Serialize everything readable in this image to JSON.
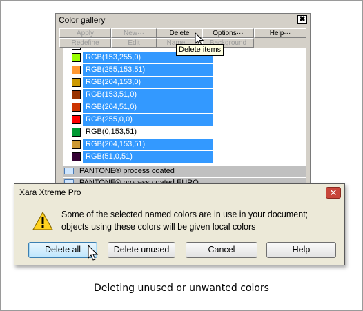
{
  "gallery": {
    "title": "Color gallery",
    "close_glyph": "✖",
    "toolbar_row1": [
      {
        "label": "Apply",
        "enabled": false
      },
      {
        "label": "New···",
        "enabled": false
      },
      {
        "label": "Delete",
        "enabled": true
      },
      {
        "label": "Options···",
        "enabled": true
      },
      {
        "label": "Help···",
        "enabled": true
      }
    ],
    "toolbar_row2": [
      {
        "label": "Redefine",
        "enabled": false
      },
      {
        "label": "Edit",
        "enabled": false
      },
      {
        "label": "Name···",
        "enabled": false
      },
      {
        "label": "Background",
        "enabled": false
      }
    ],
    "colors": [
      {
        "label": "RGB(153,255,0)",
        "swatch": "#99ff00",
        "selected": true
      },
      {
        "label": "RGB(255,153,51)",
        "swatch": "#ff9933",
        "selected": true
      },
      {
        "label": "RGB(204,153,0)",
        "swatch": "#cc9900",
        "selected": true
      },
      {
        "label": "RGB(153,51,0)",
        "swatch": "#993300",
        "selected": true
      },
      {
        "label": "RGB(204,51,0)",
        "swatch": "#cc3300",
        "selected": true
      },
      {
        "label": "RGB(255,0,0)",
        "swatch": "#ff0000",
        "selected": true
      },
      {
        "label": "RGB(0,153,51)",
        "swatch": "#009933",
        "selected": false
      },
      {
        "label": "RGB(204,153,51)",
        "swatch": "#cc9933",
        "selected": true
      },
      {
        "label": "RGB(51,0,51)",
        "swatch": "#330033",
        "selected": true
      }
    ],
    "folders": [
      {
        "label": "PANTONE® process coated"
      },
      {
        "label": "PANTONE® process coated EURO"
      }
    ],
    "tooltip": "Delete items"
  },
  "dialog": {
    "title": "Xara Xtreme Pro",
    "close_glyph": "✕",
    "message_line1": "Some of the selected named colors are in use in your document;",
    "message_line2": "objects using these colors will be given local colors",
    "buttons": {
      "delete_all": "Delete all",
      "delete_unused": "Delete unused",
      "cancel": "Cancel",
      "help": "Help"
    }
  },
  "caption": "Deleting unused or unwanted colors",
  "colors": {
    "selection": "#3399ff",
    "panel": "#d4d0c8",
    "dialog_bg": "#ece9d8"
  }
}
